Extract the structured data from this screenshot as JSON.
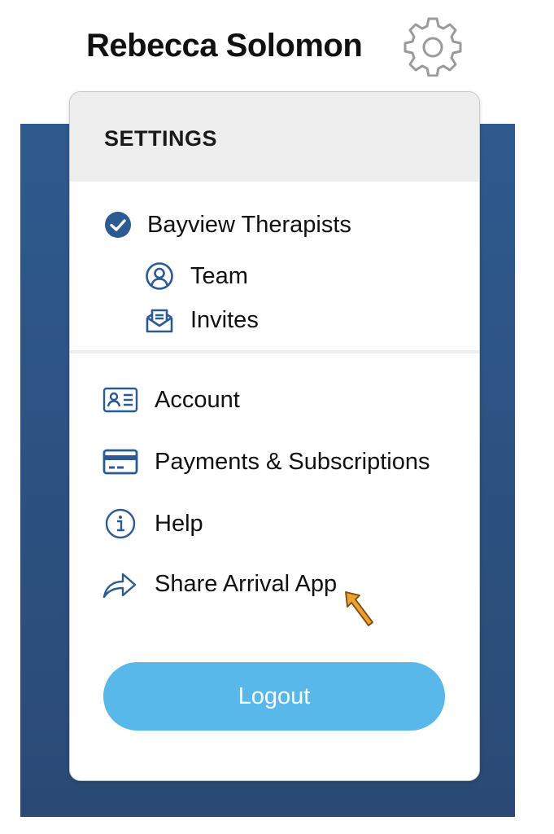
{
  "header": {
    "user_name": "Rebecca Solomon",
    "settings_icon": "gear-icon"
  },
  "menu": {
    "title": "SETTINGS",
    "organization": {
      "label": "Bayview Therapists",
      "icon": "check-circle-icon",
      "selected": true,
      "children": [
        {
          "label": "Team",
          "icon": "user-circle-icon"
        },
        {
          "label": "Invites",
          "icon": "envelope-open-icon"
        }
      ]
    },
    "items": [
      {
        "label": "Account",
        "icon": "id-card-icon"
      },
      {
        "label": "Payments & Subscriptions",
        "icon": "credit-card-icon"
      },
      {
        "label": "Help",
        "icon": "info-circle-icon"
      },
      {
        "label": "Share Arrival App",
        "icon": "share-arrow-icon"
      }
    ],
    "logout_label": "Logout"
  },
  "colors": {
    "accent_blue": "#2c5a93",
    "logout_button": "#57b8e9",
    "backdrop_top": "#2f5a8e",
    "backdrop_bottom": "#2a4a75",
    "panel_header": "#eeeeee",
    "cursor": "#f0a030"
  }
}
